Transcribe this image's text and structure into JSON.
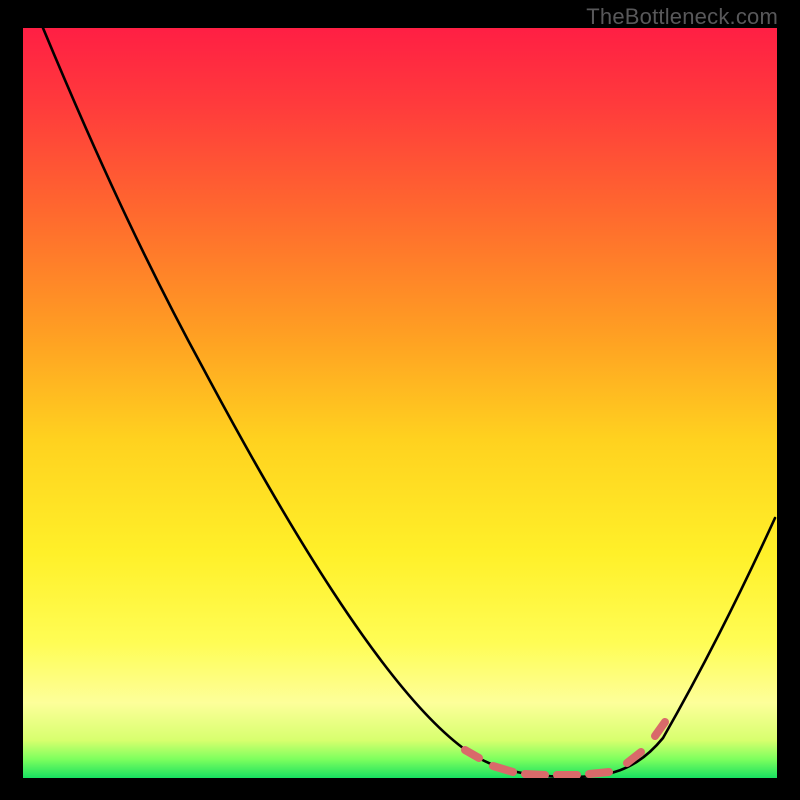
{
  "watermark": "TheBottleneck.com",
  "chart_data": {
    "type": "line",
    "title": "",
    "xlabel": "",
    "ylabel": "",
    "xlim": [
      0,
      100
    ],
    "ylim": [
      0,
      100
    ],
    "legend": false,
    "grid": false,
    "background_gradient": {
      "orientation": "vertical",
      "stops": [
        {
          "offset": 0.0,
          "color": "#ff1f44"
        },
        {
          "offset": 0.25,
          "color": "#ff6a2e"
        },
        {
          "offset": 0.55,
          "color": "#ffd21f"
        },
        {
          "offset": 0.85,
          "color": "#fdff9a"
        },
        {
          "offset": 1.0,
          "color": "#18e060"
        }
      ]
    },
    "series": [
      {
        "name": "bottleneck_curve",
        "color": "#000000",
        "x": [
          3,
          10,
          18,
          24,
          32,
          40,
          48,
          56,
          62,
          68,
          72,
          76,
          80,
          84,
          88,
          92,
          96,
          100
        ],
        "y": [
          100,
          88,
          76,
          66,
          54,
          42,
          30,
          18,
          10,
          4,
          1,
          0,
          1,
          4,
          12,
          22,
          30,
          36
        ]
      }
    ],
    "annotations": {
      "optimal_zone": {
        "style": "dashed",
        "color": "#d96a6a",
        "x_range": [
          58,
          86
        ],
        "description": "Markers highlighting the low-bottleneck region of the curve"
      }
    }
  }
}
